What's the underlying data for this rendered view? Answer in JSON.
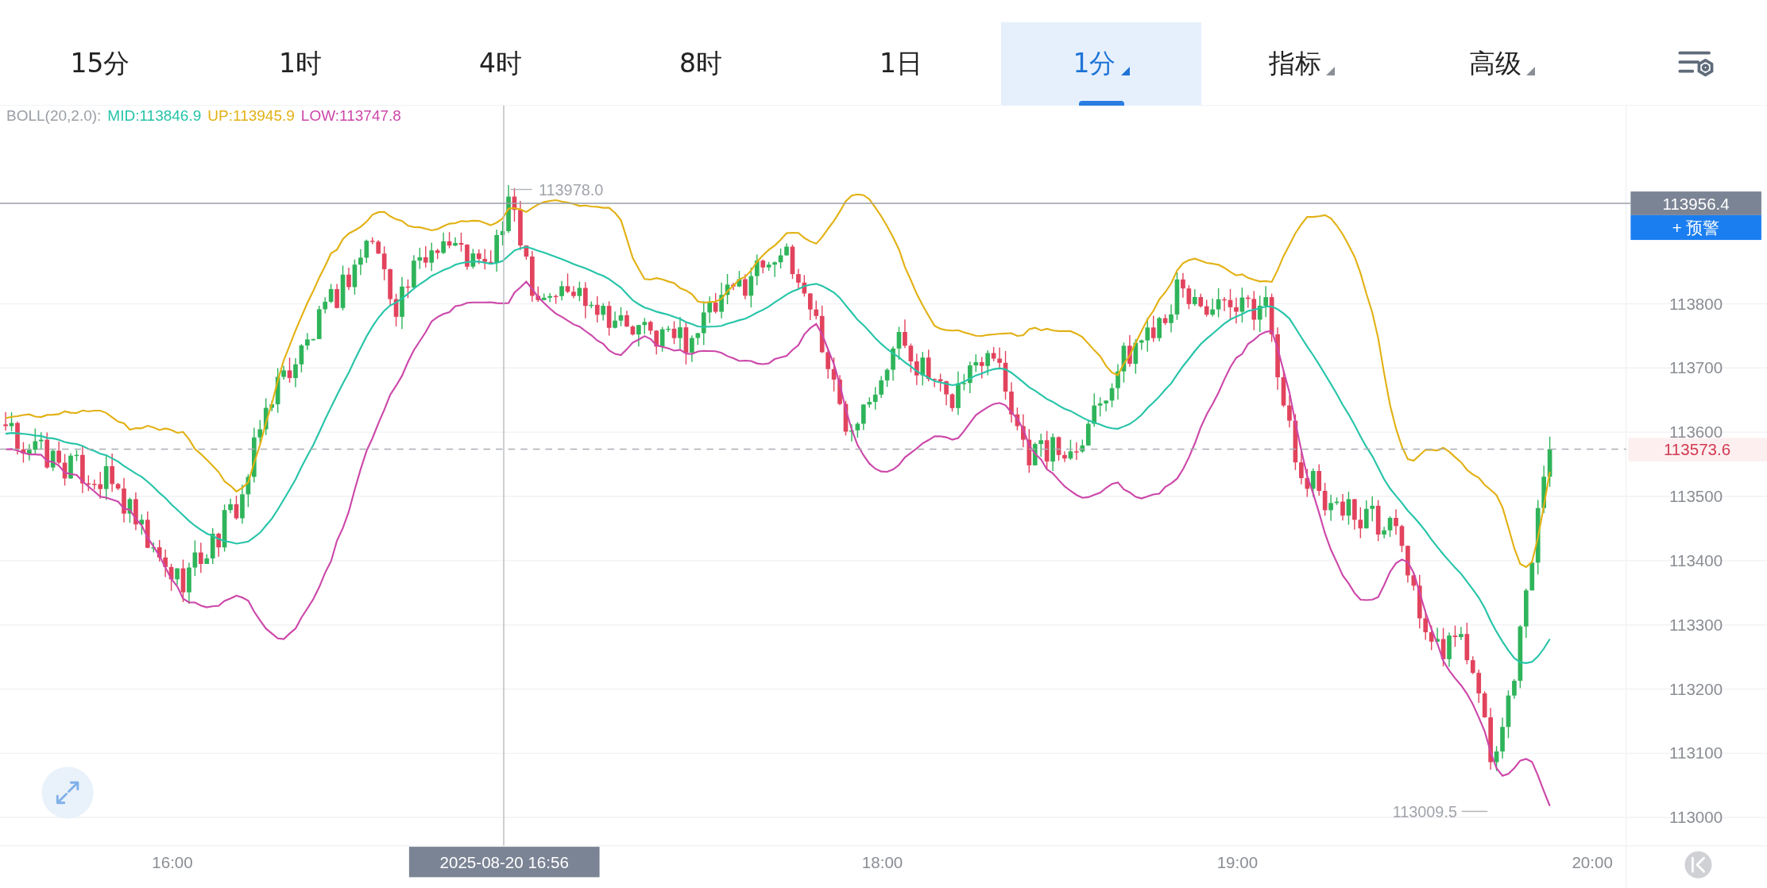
{
  "tabs": [
    {
      "label": "15分",
      "selected": false,
      "dropdown": false
    },
    {
      "label": "1时",
      "selected": false,
      "dropdown": false
    },
    {
      "label": "4时",
      "selected": false,
      "dropdown": false
    },
    {
      "label": "8时",
      "selected": false,
      "dropdown": false
    },
    {
      "label": "1日",
      "selected": false,
      "dropdown": false
    },
    {
      "label": "1分",
      "selected": true,
      "dropdown": true
    },
    {
      "label": "指标",
      "selected": false,
      "dropdown": true
    },
    {
      "label": "高级",
      "selected": false,
      "dropdown": true
    }
  ],
  "legend": {
    "label": "BOLL(20,2.0):",
    "items": [
      {
        "text": "MID:113846.9",
        "color": "#26c4a8"
      },
      {
        "text": "UP:113945.9",
        "color": "#e2b114"
      },
      {
        "text": "LOW:113747.8",
        "color": "#cc47a9"
      }
    ]
  },
  "y_axis": {
    "ticks": [
      "113800",
      "113700",
      "113600",
      "113500",
      "113400",
      "113300",
      "113200",
      "113100",
      "113000"
    ]
  },
  "x_axis": {
    "ticks": [
      "16:00",
      "18:00",
      "19:00",
      "20:00"
    ]
  },
  "crosshair": {
    "price": "113956.4",
    "time": "2025-08-20 16:56"
  },
  "alert_button": "+ 预警",
  "last_price": "113573.6",
  "high_marker": "113978.0",
  "low_marker": "113009.5"
}
